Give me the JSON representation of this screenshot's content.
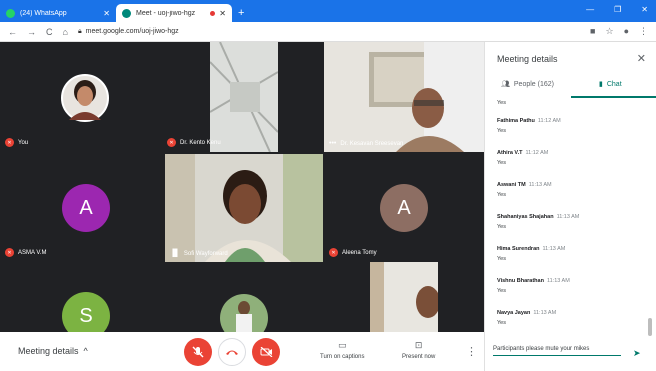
{
  "browser": {
    "tabs": [
      {
        "label": "(24) WhatsApp",
        "close": "✕"
      },
      {
        "label": "Meet - uoj-jiwo-hgz",
        "close": "✕"
      }
    ],
    "new_tab": "+",
    "url": "meet.google.com/uoj-jiwo-hgz"
  },
  "participants": [
    {
      "name": "You",
      "muted": true
    },
    {
      "name": "Dr. Kento Kenu",
      "muted": true
    },
    {
      "name": "Dr. Kesavan Sreesevan",
      "muted": false
    },
    {
      "name": "ASMA V.M",
      "muted": true,
      "initial": "A",
      "color": "#9c27b0"
    },
    {
      "name": "Sofi Wayforward",
      "muted": false
    },
    {
      "name": "Aleena Tomy",
      "muted": true,
      "initial": "A",
      "color": "#8d6e63"
    },
    {
      "name": "",
      "initial": "S",
      "color": "#7cb342"
    }
  ],
  "bottom": {
    "meeting_details": "Meeting details",
    "captions": "Turn on captions",
    "present": "Present now"
  },
  "panel": {
    "title": "Meeting details",
    "people_tab": "People (162)",
    "chat_tab": "Chat",
    "top_text": "Yes",
    "messages": [
      {
        "who": "Fathima Pathu",
        "time": "11:12 AM",
        "text": "Yes"
      },
      {
        "who": "Athira V.T",
        "time": "11:12 AM",
        "text": "Yes"
      },
      {
        "who": "Aswani TM",
        "time": "11:13 AM",
        "text": "Yes"
      },
      {
        "who": "Shahaniyas Shajahan",
        "time": "11:13 AM",
        "text": "Yes"
      },
      {
        "who": "Hima Surendran",
        "time": "11:13 AM",
        "text": "Yes"
      },
      {
        "who": "Vishnu Bharathan",
        "time": "11:13 AM",
        "text": "Yes"
      },
      {
        "who": "Navya Jayan",
        "time": "11:13 AM",
        "text": "Yes"
      }
    ],
    "input_value": "Participants please mute your mikes"
  },
  "colors": {
    "brand": "#1a73e8",
    "accent": "#00796b",
    "end_call": "#ea4335"
  }
}
